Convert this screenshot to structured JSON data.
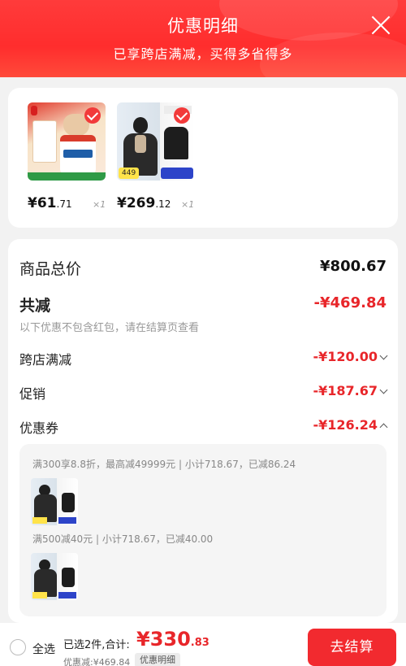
{
  "header": {
    "title": "优惠明细",
    "subtitle": "已享跨店满减，买得多省得多"
  },
  "products": [
    {
      "name": "vitamin-product",
      "price_yuan": "¥61",
      "price_cents": ".71",
      "qty": "×1"
    },
    {
      "name": "jacket-product",
      "price_yuan": "¥269",
      "price_cents": ".12",
      "qty": "×1",
      "tag": "449"
    }
  ],
  "summary": {
    "total_label": "商品总价",
    "total_value": "¥800.67",
    "reduce_label": "共减",
    "reduce_value": "-¥469.84",
    "note": "以下优惠不包含红包，请在结算页查看",
    "cross_store_label": "跨店满减",
    "cross_store_value": "-¥120.00",
    "promo_label": "促销",
    "promo_value": "-¥187.67",
    "coupon_label": "优惠券",
    "coupon_value": "-¥126.24"
  },
  "coupons": [
    {
      "text": "满300享8.8折，最高减49999元 | 小计718.67，已减86.24",
      "thumb_tag": "449"
    },
    {
      "text": "满500减40元 | 小计718.67，已减40.00",
      "thumb_tag": "449"
    }
  ],
  "footer": {
    "select_all": "全选",
    "summary": "已选2件,合计:",
    "total_main": "¥330",
    "total_cents": ".83",
    "savings": "优惠减:¥469.84",
    "detail_chip": "优惠明细",
    "checkout": "去结算"
  },
  "colors": {
    "accent": "#e8262a",
    "header": "#ff3b3b"
  }
}
